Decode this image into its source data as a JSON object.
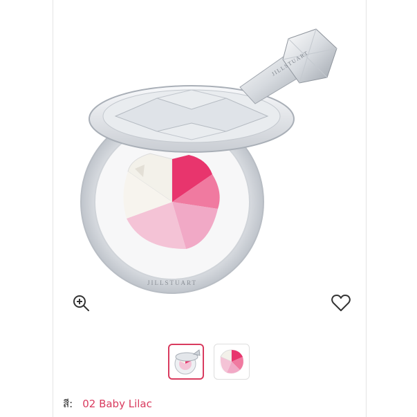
{
  "product": {
    "brand_label": "JILLSTUART",
    "image_alt": "JILLSTUART blush compact with diamond-shaped lid"
  },
  "actions": {
    "zoom_icon": "zoom-in-icon",
    "wishlist_icon": "heart-icon"
  },
  "thumbnails": [
    {
      "name": "compact-open",
      "selected": true
    },
    {
      "name": "palette-closeup",
      "selected": false
    }
  ],
  "color": {
    "label": "สี:",
    "value": "02 Baby Lilac"
  },
  "colors": {
    "accent": "#d93a5e",
    "shade_white": "#f3f1ea",
    "shade_hot_pink": "#e8356d",
    "shade_pink": "#f07aa0",
    "shade_light_pink": "#f1a9c6",
    "shade_pale_pink": "#f4c3d6"
  }
}
